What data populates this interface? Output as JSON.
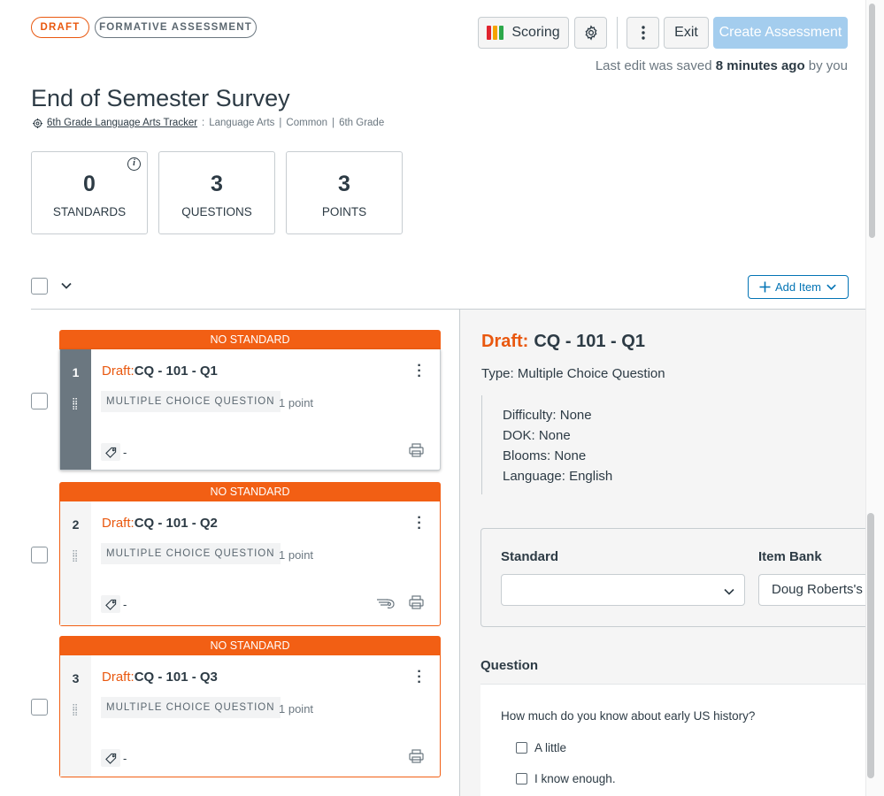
{
  "header": {
    "status_pill": "DRAFT",
    "type_pill": "FORMATIVE ASSESSMENT",
    "scoring_label": "Scoring",
    "scoring_colors": [
      "#e0242f",
      "#f5a300",
      "#2ca84a"
    ],
    "exit_label": "Exit",
    "create_label": "Create Assessment",
    "saved_prefix": "Last edit was saved",
    "saved_time": "8 minutes ago",
    "saved_suffix": "by you"
  },
  "assessment": {
    "title": "End of Semester Survey",
    "tracker": "6th Grade Language Arts Tracker",
    "separator": ":",
    "subject": "Language Arts",
    "category": "Common",
    "grade": "6th Grade",
    "pipe": "|"
  },
  "stats": [
    {
      "value": "0",
      "label": "STANDARDS"
    },
    {
      "value": "3",
      "label": "QUESTIONS"
    },
    {
      "value": "3",
      "label": "POINTS"
    }
  ],
  "toolbar": {
    "add_item_label": "Add Item"
  },
  "questions": [
    {
      "banner": "NO STANDARD",
      "index": "1",
      "draft": "Draft:",
      "name": "CQ - 101 - Q1",
      "type": "MULTIPLE CHOICE QUESTION",
      "points": "1 point",
      "tag_text": "-"
    },
    {
      "banner": "NO STANDARD",
      "index": "2",
      "draft": "Draft:",
      "name": "CQ - 101 - Q2",
      "type": "MULTIPLE CHOICE QUESTION",
      "points": "1 point",
      "tag_text": "-"
    },
    {
      "banner": "NO STANDARD",
      "index": "3",
      "draft": "Draft:",
      "name": "CQ - 101 - Q3",
      "type": "MULTIPLE CHOICE QUESTION",
      "points": "1 point",
      "tag_text": "-"
    }
  ],
  "detail": {
    "draft": "Draft:",
    "name": "CQ - 101 - Q1",
    "type": "Type: Multiple Choice Question",
    "difficulty": "Difficulty: None",
    "dok": "DOK: None",
    "blooms": "Blooms: None",
    "language": "Language: English",
    "standard_label": "Standard",
    "standard_value": "",
    "item_bank_label": "Item Bank",
    "item_bank_value": "Doug Roberts's",
    "question_label": "Question",
    "question_text": "How much do you know about early US history?",
    "options": [
      "A little",
      "I know enough."
    ]
  }
}
